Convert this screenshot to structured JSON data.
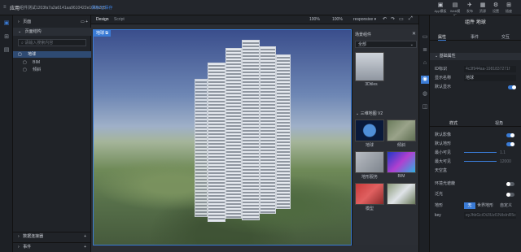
{
  "app": {
    "title": "应用",
    "subtitle": "组件测试1203fa7a2a6141aa9610422e10f0b3c8",
    "link": "保存/已保存"
  },
  "top_actions": [
    {
      "label": "App模板",
      "icon": "app-icon"
    },
    {
      "label": "Web模板",
      "icon": "web-icon"
    },
    {
      "label": "发布",
      "icon": "publish-icon"
    },
    {
      "label": "资源",
      "icon": "resource-icon"
    },
    {
      "label": "设置",
      "icon": "settings-icon"
    },
    {
      "label": "插座",
      "icon": "plugin-icon"
    }
  ],
  "editor_tabs": {
    "design": "Design",
    "script": "Script"
  },
  "zoom": {
    "left": "100%",
    "right": "100%",
    "mode": "responsive ▾"
  },
  "left_panel": {
    "pages_header": "页面",
    "tree_header": "页面结构",
    "search_placeholder": "请输入搜索内容",
    "tree": [
      {
        "label": "地球",
        "selected": true
      },
      {
        "label": "BIM",
        "selected": false
      },
      {
        "label": "倾斜",
        "selected": false
      }
    ],
    "data_header": "数据连接器",
    "scene_header": "事件"
  },
  "viewport_badge": "地球",
  "browser": {
    "title": "场景组件",
    "select_value": "全部",
    "section1_thumb": "3Dtiles",
    "section2_header": "三维地图 V2",
    "thumbs": [
      "地球",
      "倾斜",
      "地形服务",
      "BIM",
      "模型",
      ""
    ]
  },
  "right_panel": {
    "title": "组件 地球",
    "tabs": [
      "属性",
      "事件",
      "交互"
    ],
    "section_basic": "基础属性",
    "id_label": "ID标识",
    "id_value": "4c3f944aa-1981837271f",
    "name_label": "显示名称",
    "name_value": "地球",
    "default_visible_label": "默认显示",
    "subtabs": [
      "样式",
      "视角"
    ],
    "rows": [
      {
        "label": "默认影像",
        "on": true
      },
      {
        "label": "默认地形",
        "on": true
      },
      {
        "label": "最小可见",
        "value": "1.1"
      },
      {
        "label": "最大可见",
        "value": "12000"
      },
      {
        "label": "天空盒",
        "on": false
      },
      {
        "label": "环境光遮蔽",
        "on": false
      },
      {
        "label": "泛光",
        "on": false
      }
    ],
    "terrain_label": "地形",
    "terrain_options": [
      "无",
      "世界地形",
      "自定义"
    ],
    "key_label": "key",
    "key_value": "eyJhbGciOiJIUzI1NiIsInR5cCI6"
  },
  "colors": {
    "accent": "#3a7bd5",
    "panel": "#202328"
  }
}
